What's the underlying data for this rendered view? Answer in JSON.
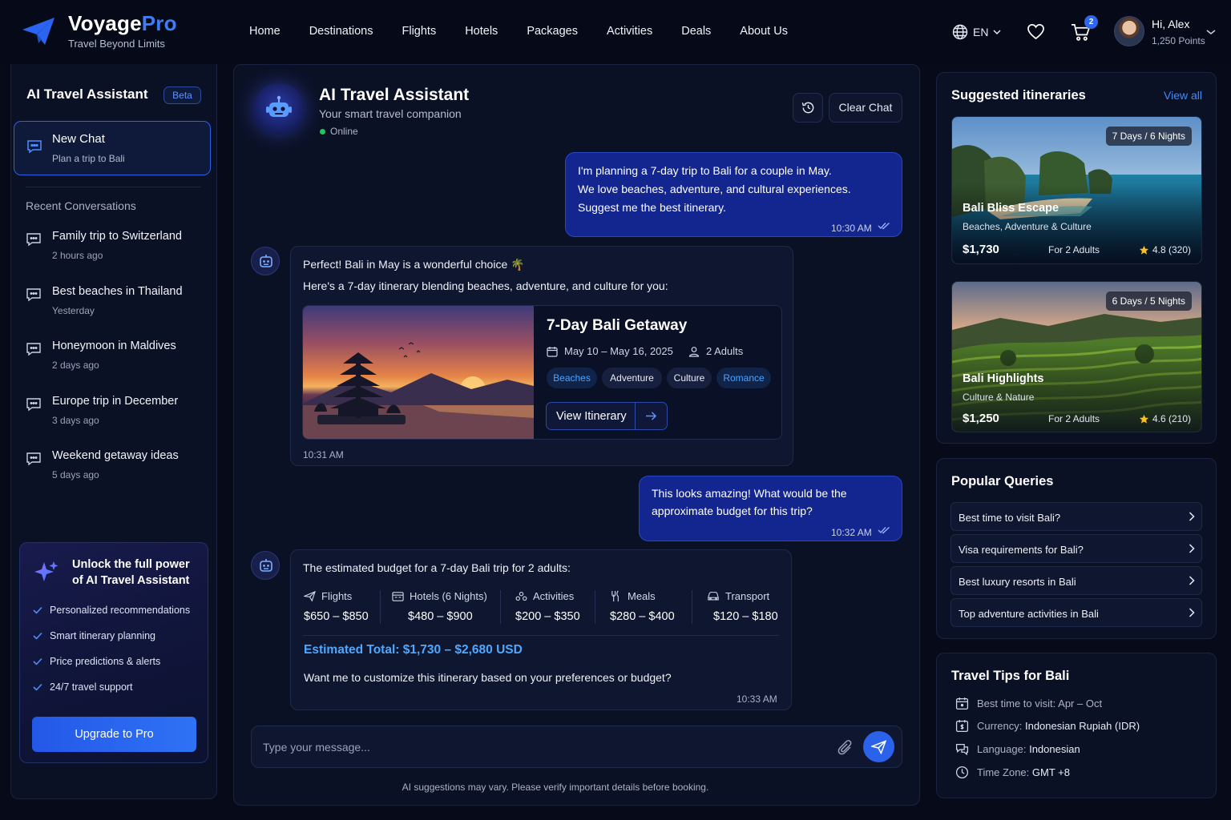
{
  "brand": {
    "name_a": "Voyage",
    "name_b": "Pro",
    "tagline": "Travel Beyond Limits"
  },
  "nav": [
    "Home",
    "Destinations",
    "Flights",
    "Hotels",
    "Packages",
    "Activities",
    "Deals",
    "About Us"
  ],
  "header": {
    "lang": "EN",
    "cart_count": "2",
    "user_greeting": "Hi, Alex",
    "user_points": "1,250 Points"
  },
  "sidebar": {
    "title": "AI Travel Assistant",
    "badge": "Beta",
    "new_chat": {
      "title": "New Chat",
      "subtitle": "Plan a trip to Bali"
    },
    "recent_label": "Recent Conversations",
    "conversations": [
      {
        "title": "Family trip to Switzerland",
        "time": "2 hours ago"
      },
      {
        "title": "Best beaches in Thailand",
        "time": "Yesterday"
      },
      {
        "title": "Honeymoon in Maldives",
        "time": "2 days ago"
      },
      {
        "title": "Europe trip in December",
        "time": "3 days ago"
      },
      {
        "title": "Weekend getaway ideas",
        "time": "5 days ago"
      }
    ],
    "pro": {
      "heading": "Unlock the full power of AI Travel Assistant",
      "features": [
        "Personalized recommendations",
        "Smart itinerary planning",
        "Price predictions & alerts",
        "24/7 travel support"
      ],
      "button": "Upgrade to Pro"
    }
  },
  "chat": {
    "title": "AI Travel Assistant",
    "subtitle": "Your smart travel companion",
    "status": "Online",
    "clear_label": "Clear Chat",
    "msg1": {
      "lines": [
        "I'm planning a 7-day trip to Bali for a couple in May.",
        "We love beaches, adventure, and cultural experiences.",
        "Suggest me the best itinerary."
      ],
      "time": "10:30 AM"
    },
    "msg2": {
      "line1": "Perfect! Bali in May is a wonderful choice 🌴",
      "line2": "Here's a 7-day itinerary blending beaches, adventure, and culture for you:",
      "card": {
        "title": "7-Day Bali Getaway",
        "dates": "May 10 – May 16, 2025",
        "guests": "2 Adults",
        "tags": [
          "Beaches",
          "Adventure",
          "Culture",
          "Romance"
        ],
        "button": "View Itinerary"
      },
      "time": "10:31 AM"
    },
    "msg3": {
      "lines": [
        "This looks amazing! What would be the",
        "approximate budget for this trip?"
      ],
      "time": "10:32 AM"
    },
    "msg4": {
      "intro": "The estimated budget for a 7-day Bali trip for 2 adults:",
      "items": [
        {
          "label": "Flights",
          "value": "$650 – $850"
        },
        {
          "label": "Hotels (6 Nights)",
          "value": "$480 – $900"
        },
        {
          "label": "Activities",
          "value": "$200 – $350"
        },
        {
          "label": "Meals",
          "value": "$280 – $400"
        },
        {
          "label": "Transport",
          "value": "$120 – $180"
        }
      ],
      "total": "Estimated Total: $1,730 – $2,680 USD",
      "question": "Want me to customize this itinerary based on your preferences or budget?",
      "time": "10:33 AM"
    },
    "input_placeholder": "Type your message...",
    "disclaimer": "AI suggestions may vary. Please verify important details before booking."
  },
  "itineraries": {
    "heading": "Suggested itineraries",
    "view_all": "View all",
    "items": [
      {
        "duration": "7 Days / 6 Nights",
        "name": "Bali Bliss Escape",
        "desc": "Beaches, Adventure & Culture",
        "price": "$1,730",
        "for": "For 2 Adults",
        "rating": "4.8 (320)"
      },
      {
        "duration": "6 Days / 5 Nights",
        "name": "Bali Highlights",
        "desc": "Culture & Nature",
        "price": "$1,250",
        "for": "For 2 Adults",
        "rating": "4.6 (210)"
      }
    ]
  },
  "popular": {
    "heading": "Popular Queries",
    "items": [
      "Best time to visit Bali?",
      "Visa requirements for Bali?",
      "Best luxury resorts in Bali",
      "Top adventure activities in Bali"
    ]
  },
  "tips": {
    "heading": "Travel Tips for Bali",
    "items": [
      {
        "label": "Best time to visit:",
        "value": "Apr – Oct"
      },
      {
        "label": "Currency:",
        "value": "Indonesian Rupiah (IDR)"
      },
      {
        "label": "Language:",
        "value": "Indonesian"
      },
      {
        "label": "Time Zone:",
        "value": "GMT +8"
      }
    ]
  },
  "colors": {
    "accent": "#2d66f0",
    "user_bubble": "#13268f",
    "total": "#4ea8ff",
    "online": "#22c55e"
  }
}
